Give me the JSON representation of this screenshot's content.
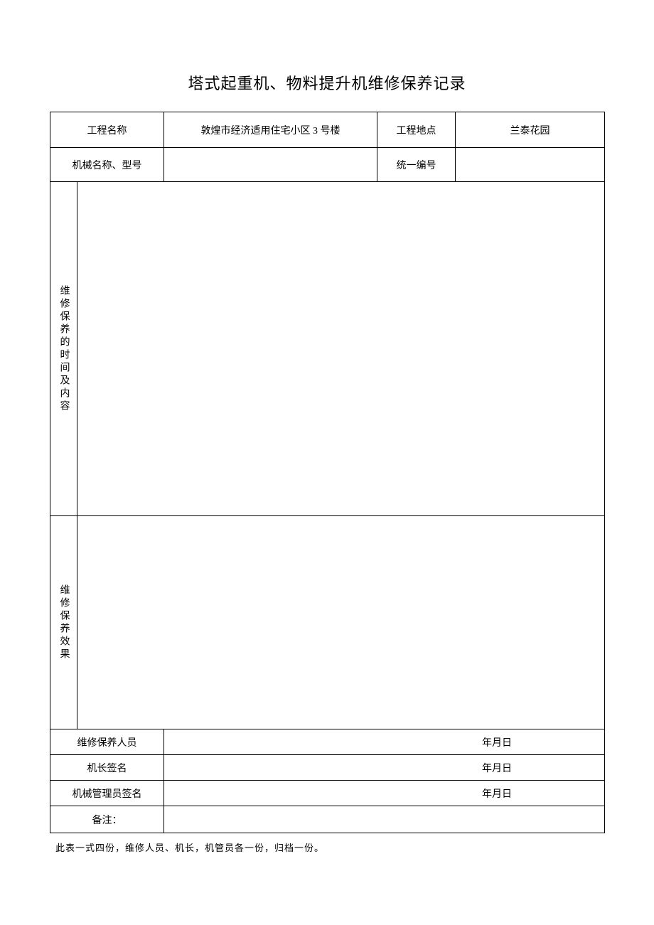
{
  "title": "塔式起重机、物料提升机维修保养记录",
  "row1": {
    "label1": "工程名称",
    "value1": "敦煌市经济适用住宅小区 3 号楼",
    "label2": "工程地点",
    "value2": "兰泰花园"
  },
  "row2": {
    "label1": "机械名称、型号",
    "value1": "",
    "label2": "统一编号",
    "value2": ""
  },
  "section1": {
    "label": "维修保养的时间及内容",
    "content": ""
  },
  "section2": {
    "label": "维修保养效果",
    "content": ""
  },
  "sig1": {
    "label": "维修保养人员",
    "date": "年月日"
  },
  "sig2": {
    "label": "机长签名",
    "date": "年月日"
  },
  "sig3": {
    "label": "机械管理员签名",
    "date": "年月日"
  },
  "remark": {
    "label": "备注：",
    "content": ""
  },
  "footer": "此表一式四份，维修人员、机长，机管员各一份，归档一份。"
}
